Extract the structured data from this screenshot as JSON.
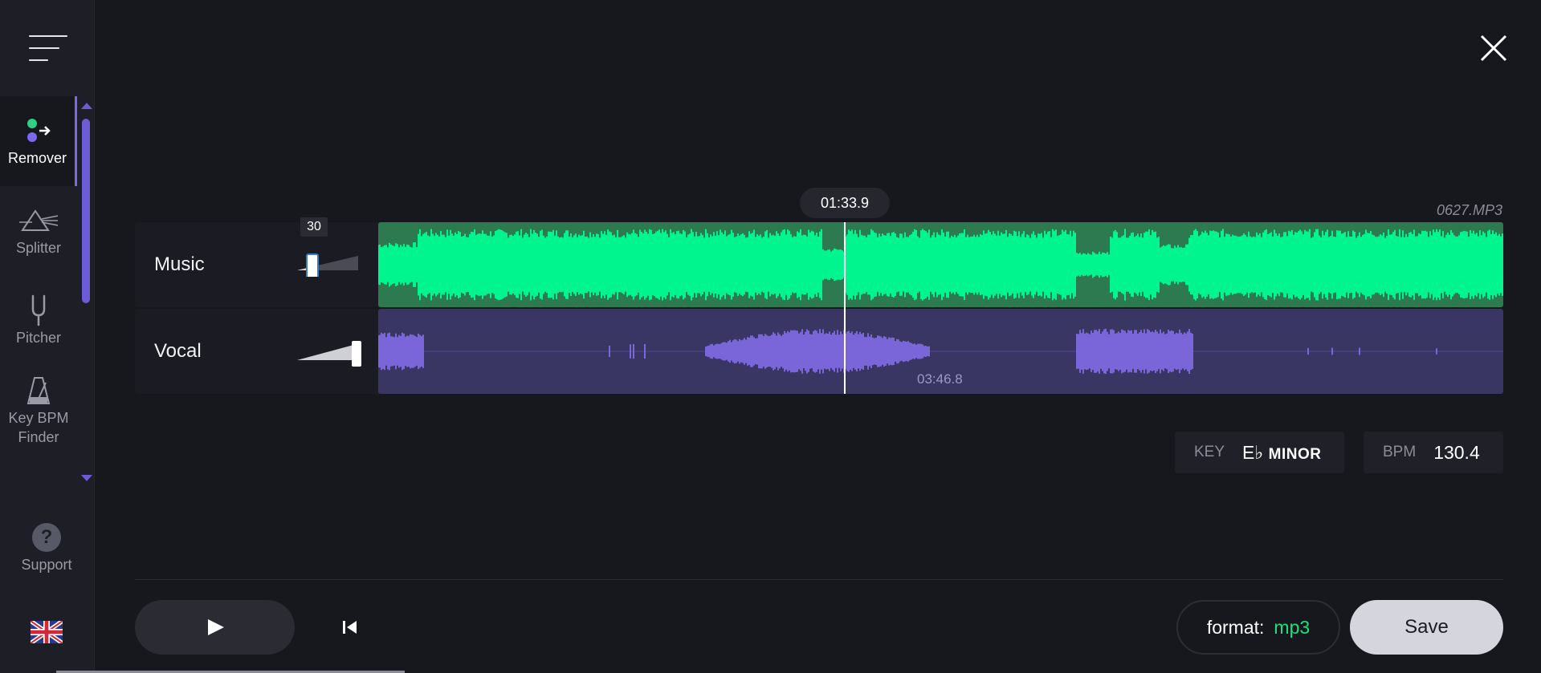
{
  "sidebar": {
    "items": [
      {
        "label": "Remover",
        "icon": "remover-icon",
        "active": true
      },
      {
        "label": "Splitter",
        "icon": "prism-icon"
      },
      {
        "label": "Pitcher",
        "icon": "tuning-fork-icon"
      },
      {
        "label": "Key BPM Finder",
        "icon": "metronome-icon"
      }
    ],
    "support_label": "Support",
    "language_icon": "uk-flag-icon"
  },
  "player": {
    "current_time": "01:33.9",
    "filename": "0627.MP3",
    "duration": "03:46.8",
    "tracks": [
      {
        "label": "Music",
        "volume": 30,
        "volume_tooltip": "30",
        "color": "#00f58e"
      },
      {
        "label": "Vocal",
        "volume": 100,
        "color": "#7a66d8"
      }
    ]
  },
  "analysis": {
    "key_label": "KEY",
    "key_note": "E♭",
    "key_mode": "MINOR",
    "bpm_label": "BPM",
    "bpm_value": "130.4"
  },
  "controls": {
    "format_label": "format:",
    "format_value": "mp3",
    "save_label": "Save"
  },
  "colors": {
    "accent": "#6c5cd8",
    "music_wave": "#00f58e",
    "vocal_wave": "#7a66d8",
    "background": "#17181e"
  }
}
